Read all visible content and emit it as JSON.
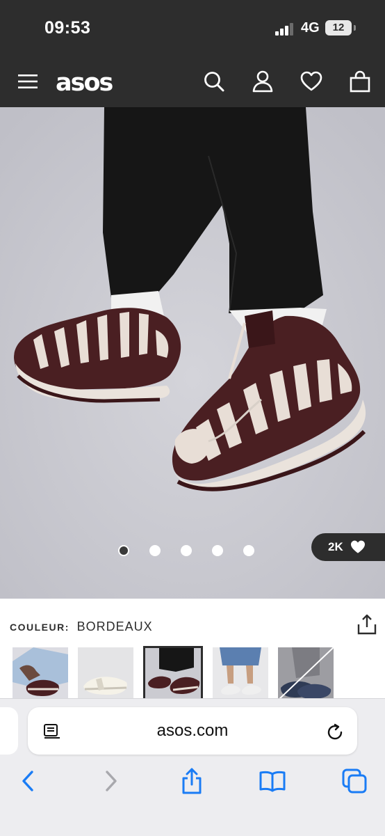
{
  "status_bar": {
    "time": "09:53",
    "network": "4G",
    "battery": "12"
  },
  "header": {
    "logo": "asos"
  },
  "gallery": {
    "image_count": 5,
    "active_index": 0,
    "likes": "2K"
  },
  "product": {
    "colour_label": "COULEUR:",
    "colour_value": "BORDEAUX",
    "swatches": [
      {
        "name": "swatch-1"
      },
      {
        "name": "swatch-2"
      },
      {
        "name": "swatch-3",
        "selected": true
      },
      {
        "name": "swatch-4"
      },
      {
        "name": "swatch-5"
      }
    ]
  },
  "browser": {
    "url": "asos.com"
  },
  "colors": {
    "dark": "#2d2d2d",
    "accent": "#1a7cf5",
    "shoe": "#4a1f22",
    "cream": "#e8ded6"
  }
}
